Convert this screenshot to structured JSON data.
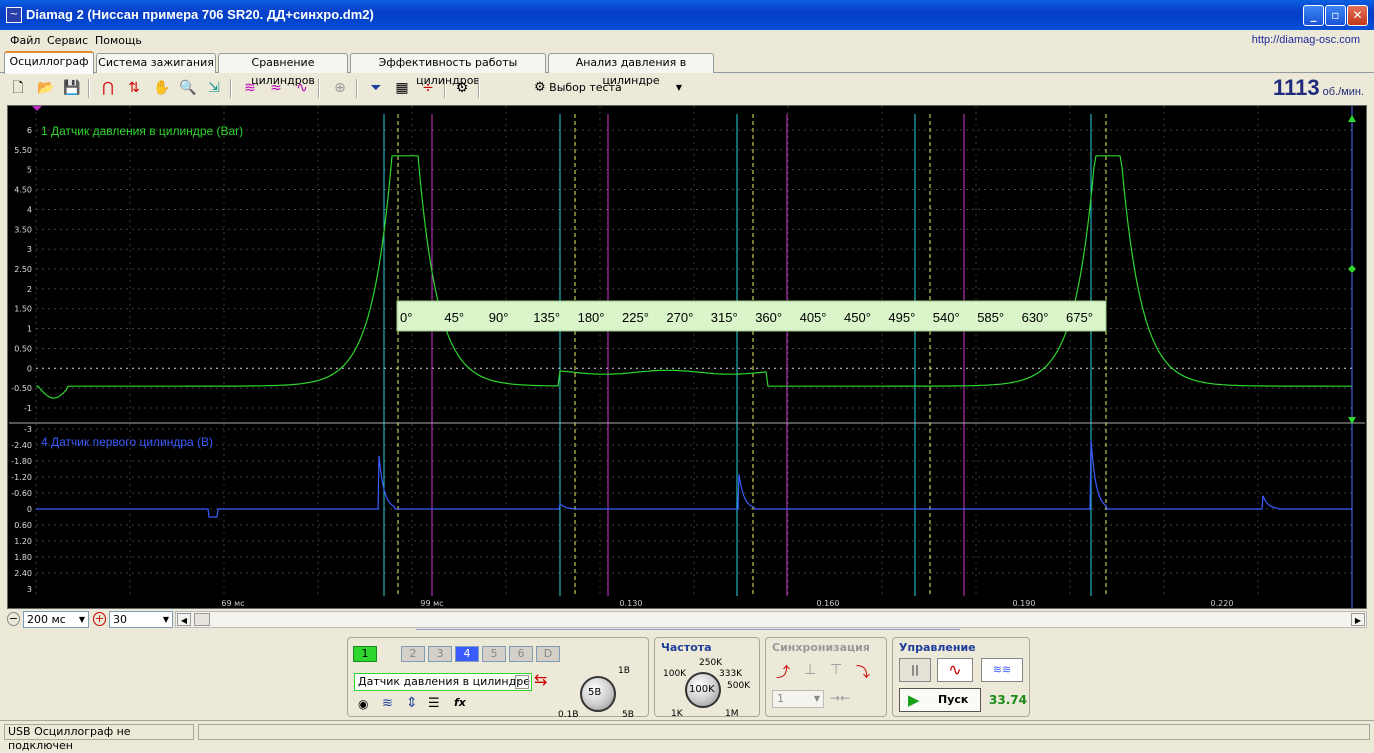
{
  "window": {
    "title": "Diamag 2 (Ниссан примера 706 SR20. ДД+синхро.dm2)",
    "url": "http://diamag-osc.com"
  },
  "menu": [
    "Файл",
    "Сервис",
    "Помощь"
  ],
  "tabs": [
    "Осциллограф",
    "Система зажигания",
    "Сравнение цилиндров",
    "Эффективность работы цилиндров",
    "Анализ давления в цилиндре"
  ],
  "toolbar": {
    "test_select": "Выбор теста",
    "rpm_value": "1113",
    "rpm_unit": "об./мин."
  },
  "scope": {
    "ch1_label": "1 Датчик давления в цилиндре (Bar)",
    "ch4_label": "4 Датчик первого цилиндра (В)",
    "ch1_ticks": [
      "6",
      "5.50",
      "5",
      "4.50",
      "4",
      "3.50",
      "3",
      "2.50",
      "2",
      "1.50",
      "1",
      "0.50",
      "0",
      "-0.50",
      "-1"
    ],
    "ch4_ticks": [
      "-3",
      "-2.40",
      "-1.80",
      "-1.20",
      "-0.60",
      "0",
      "0.60",
      "1.20",
      "1.80",
      "2.40",
      "3"
    ],
    "time_labels": [
      "69 мс",
      "99 мс",
      "0.130",
      "0.160",
      "0.190",
      "0.220"
    ],
    "degrees": [
      "0°",
      "45°",
      "90°",
      "135°",
      "180°",
      "225°",
      "270°",
      "315°",
      "360°",
      "405°",
      "450°",
      "495°",
      "540°",
      "585°",
      "630°",
      "675°"
    ],
    "colors": {
      "ch1": "#2ed62e",
      "ch4": "#3a5cff",
      "cyan": "#2ad4e0",
      "magenta": "#d23ad2",
      "yellow": "#f0f060"
    }
  },
  "scrollbar": {
    "timebase": "200",
    "timebase_unit": "мс",
    "count": "30"
  },
  "channels": {
    "buttons": [
      "1",
      "2",
      "3",
      "4",
      "5",
      "6",
      "D"
    ],
    "sensor": "Датчик давления в цилиндре",
    "knob_value": "5В",
    "knob_min": "0.1В",
    "knob_top": "1В",
    "knob_max": "5В"
  },
  "frequency": {
    "title": "Частота",
    "value": "100K",
    "labels": [
      "100K",
      "250K",
      "333K",
      "500K",
      "1K",
      "1M"
    ]
  },
  "sync": {
    "title": "Синхронизация",
    "select": "1"
  },
  "control": {
    "title": "Управление",
    "start": "Пуск",
    "value": "33.74"
  },
  "status": {
    "text": "USB Осциллограф не подключен"
  }
}
